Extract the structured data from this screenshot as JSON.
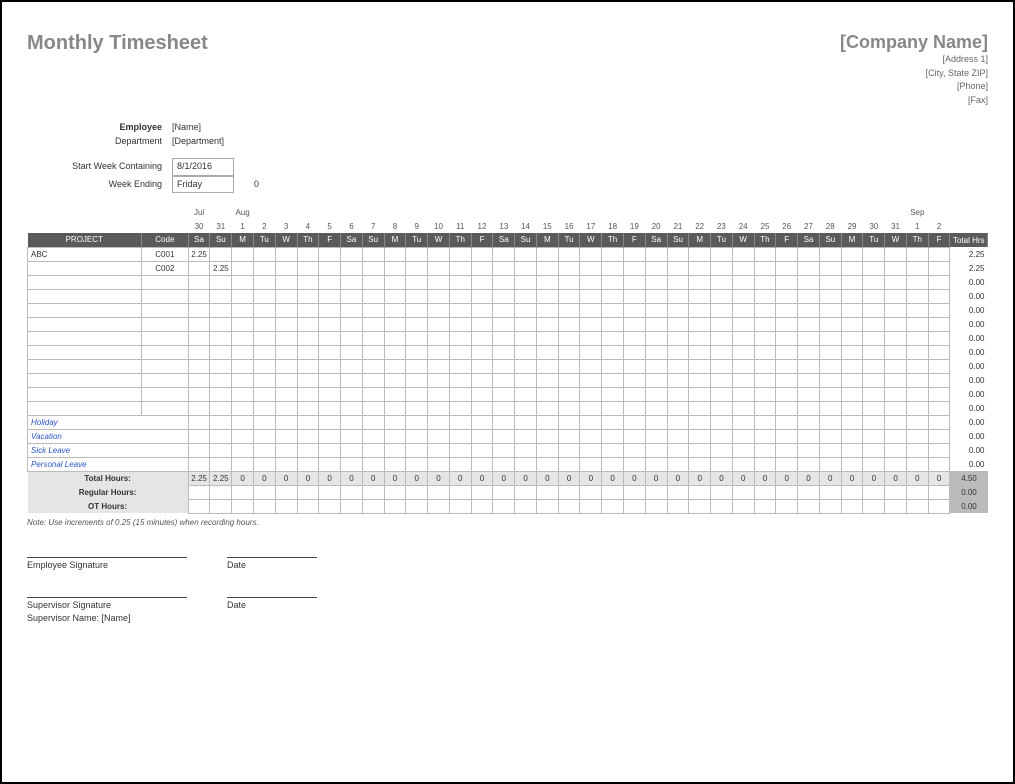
{
  "title": "Monthly Timesheet",
  "company": {
    "name": "[Company Name]",
    "address1": "[Address 1]",
    "city_state_zip": "[City, State ZIP]",
    "phone": "[Phone]",
    "fax": "[Fax]"
  },
  "meta": {
    "employee_label": "Employee",
    "employee_value": "[Name]",
    "department_label": "Department",
    "department_value": "[Department]",
    "start_week_label": "Start Week Containing",
    "start_week_value": "8/1/2016",
    "week_ending_label": "Week Ending",
    "week_ending_value": "Friday",
    "week_ending_extra": "0"
  },
  "calendar": {
    "months": [
      {
        "label": "Jul",
        "span_start": 0
      },
      {
        "label": "Aug",
        "span_start": 2
      },
      {
        "label": "Sep",
        "span_start": 33
      }
    ],
    "dates": [
      "30",
      "31",
      "1",
      "2",
      "3",
      "4",
      "5",
      "6",
      "7",
      "8",
      "9",
      "10",
      "11",
      "12",
      "13",
      "14",
      "15",
      "16",
      "17",
      "18",
      "19",
      "20",
      "21",
      "22",
      "23",
      "24",
      "25",
      "26",
      "27",
      "28",
      "29",
      "30",
      "31",
      "1",
      "2"
    ],
    "days": [
      "Sa",
      "Su",
      "M",
      "Tu",
      "W",
      "Th",
      "F",
      "Sa",
      "Su",
      "M",
      "Tu",
      "W",
      "Th",
      "F",
      "Sa",
      "Su",
      "M",
      "Tu",
      "W",
      "Th",
      "F",
      "Sa",
      "Su",
      "M",
      "Tu",
      "W",
      "Th",
      "F",
      "Sa",
      "Su",
      "M",
      "Tu",
      "W",
      "Th",
      "F"
    ]
  },
  "headers": {
    "project": "PROJECT",
    "code": "Code",
    "total_hrs": "Total Hrs"
  },
  "rows": [
    {
      "project": "ABC",
      "code": "C001",
      "hours": {
        "0": "2.25"
      },
      "total": "2.25"
    },
    {
      "project": "",
      "code": "C002",
      "hours": {
        "1": "2.25"
      },
      "total": "2.25"
    },
    {
      "project": "",
      "code": "",
      "hours": {},
      "total": "0.00"
    },
    {
      "project": "",
      "code": "",
      "hours": {},
      "total": "0.00"
    },
    {
      "project": "",
      "code": "",
      "hours": {},
      "total": "0.00"
    },
    {
      "project": "",
      "code": "",
      "hours": {},
      "total": "0.00"
    },
    {
      "project": "",
      "code": "",
      "hours": {},
      "total": "0.00"
    },
    {
      "project": "",
      "code": "",
      "hours": {},
      "total": "0.00"
    },
    {
      "project": "",
      "code": "",
      "hours": {},
      "total": "0.00"
    },
    {
      "project": "",
      "code": "",
      "hours": {},
      "total": "0.00"
    },
    {
      "project": "",
      "code": "",
      "hours": {},
      "total": "0.00"
    },
    {
      "project": "",
      "code": "",
      "hours": {},
      "total": "0.00"
    }
  ],
  "leave_rows": [
    {
      "label": "Holiday",
      "total": "0.00"
    },
    {
      "label": "Vacation",
      "total": "0.00"
    },
    {
      "label": "Sick Leave",
      "total": "0.00"
    },
    {
      "label": "Personal Leave",
      "total": "0.00"
    }
  ],
  "totals": {
    "label": "Total Hours:",
    "per_day": [
      "2.25",
      "2.25",
      "0",
      "0",
      "0",
      "0",
      "0",
      "0",
      "0",
      "0",
      "0",
      "0",
      "0",
      "0",
      "0",
      "0",
      "0",
      "0",
      "0",
      "0",
      "0",
      "0",
      "0",
      "0",
      "0",
      "0",
      "0",
      "0",
      "0",
      "0",
      "0",
      "0",
      "0",
      "0",
      "0"
    ],
    "grand": "4.50",
    "regular_label": "Regular Hours:",
    "regular_total": "0.00",
    "ot_label": "OT Hours:",
    "ot_total": "0.00"
  },
  "note": "Note: Use increments of 0.25 (15 minutes) when recording hours.",
  "signatures": {
    "emp_sig": "Employee Signature",
    "date": "Date",
    "sup_sig": "Supervisor Signature",
    "sup_name_label": "Supervisor Name:",
    "sup_name_value": "[Name]"
  }
}
